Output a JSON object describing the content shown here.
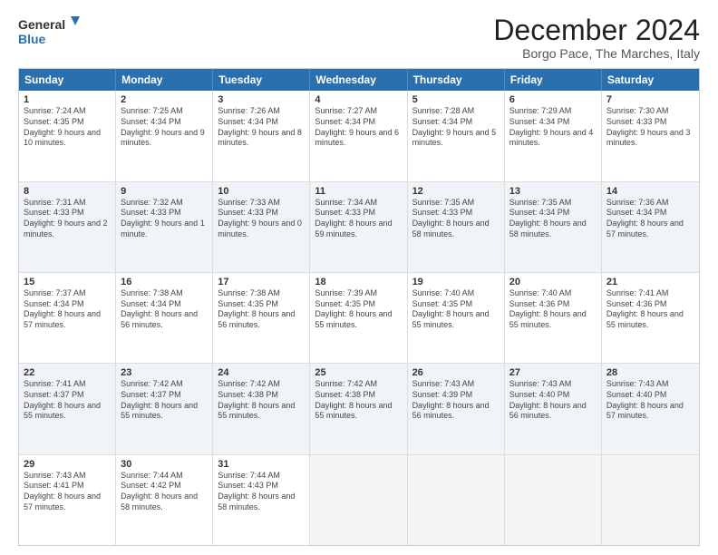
{
  "logo": {
    "line1": "General",
    "line2": "Blue"
  },
  "title": "December 2024",
  "subtitle": "Borgo Pace, The Marches, Italy",
  "header_days": [
    "Sunday",
    "Monday",
    "Tuesday",
    "Wednesday",
    "Thursday",
    "Friday",
    "Saturday"
  ],
  "weeks": [
    [
      {
        "day": "1",
        "rise": "Sunrise: 7:24 AM",
        "set": "Sunset: 4:35 PM",
        "day_text": "Daylight: 9 hours and 10 minutes."
      },
      {
        "day": "2",
        "rise": "Sunrise: 7:25 AM",
        "set": "Sunset: 4:34 PM",
        "day_text": "Daylight: 9 hours and 9 minutes."
      },
      {
        "day": "3",
        "rise": "Sunrise: 7:26 AM",
        "set": "Sunset: 4:34 PM",
        "day_text": "Daylight: 9 hours and 8 minutes."
      },
      {
        "day": "4",
        "rise": "Sunrise: 7:27 AM",
        "set": "Sunset: 4:34 PM",
        "day_text": "Daylight: 9 hours and 6 minutes."
      },
      {
        "day": "5",
        "rise": "Sunrise: 7:28 AM",
        "set": "Sunset: 4:34 PM",
        "day_text": "Daylight: 9 hours and 5 minutes."
      },
      {
        "day": "6",
        "rise": "Sunrise: 7:29 AM",
        "set": "Sunset: 4:34 PM",
        "day_text": "Daylight: 9 hours and 4 minutes."
      },
      {
        "day": "7",
        "rise": "Sunrise: 7:30 AM",
        "set": "Sunset: 4:33 PM",
        "day_text": "Daylight: 9 hours and 3 minutes."
      }
    ],
    [
      {
        "day": "8",
        "rise": "Sunrise: 7:31 AM",
        "set": "Sunset: 4:33 PM",
        "day_text": "Daylight: 9 hours and 2 minutes."
      },
      {
        "day": "9",
        "rise": "Sunrise: 7:32 AM",
        "set": "Sunset: 4:33 PM",
        "day_text": "Daylight: 9 hours and 1 minute."
      },
      {
        "day": "10",
        "rise": "Sunrise: 7:33 AM",
        "set": "Sunset: 4:33 PM",
        "day_text": "Daylight: 9 hours and 0 minutes."
      },
      {
        "day": "11",
        "rise": "Sunrise: 7:34 AM",
        "set": "Sunset: 4:33 PM",
        "day_text": "Daylight: 8 hours and 59 minutes."
      },
      {
        "day": "12",
        "rise": "Sunrise: 7:35 AM",
        "set": "Sunset: 4:33 PM",
        "day_text": "Daylight: 8 hours and 58 minutes."
      },
      {
        "day": "13",
        "rise": "Sunrise: 7:35 AM",
        "set": "Sunset: 4:34 PM",
        "day_text": "Daylight: 8 hours and 58 minutes."
      },
      {
        "day": "14",
        "rise": "Sunrise: 7:36 AM",
        "set": "Sunset: 4:34 PM",
        "day_text": "Daylight: 8 hours and 57 minutes."
      }
    ],
    [
      {
        "day": "15",
        "rise": "Sunrise: 7:37 AM",
        "set": "Sunset: 4:34 PM",
        "day_text": "Daylight: 8 hours and 57 minutes."
      },
      {
        "day": "16",
        "rise": "Sunrise: 7:38 AM",
        "set": "Sunset: 4:34 PM",
        "day_text": "Daylight: 8 hours and 56 minutes."
      },
      {
        "day": "17",
        "rise": "Sunrise: 7:38 AM",
        "set": "Sunset: 4:35 PM",
        "day_text": "Daylight: 8 hours and 56 minutes."
      },
      {
        "day": "18",
        "rise": "Sunrise: 7:39 AM",
        "set": "Sunset: 4:35 PM",
        "day_text": "Daylight: 8 hours and 55 minutes."
      },
      {
        "day": "19",
        "rise": "Sunrise: 7:40 AM",
        "set": "Sunset: 4:35 PM",
        "day_text": "Daylight: 8 hours and 55 minutes."
      },
      {
        "day": "20",
        "rise": "Sunrise: 7:40 AM",
        "set": "Sunset: 4:36 PM",
        "day_text": "Daylight: 8 hours and 55 minutes."
      },
      {
        "day": "21",
        "rise": "Sunrise: 7:41 AM",
        "set": "Sunset: 4:36 PM",
        "day_text": "Daylight: 8 hours and 55 minutes."
      }
    ],
    [
      {
        "day": "22",
        "rise": "Sunrise: 7:41 AM",
        "set": "Sunset: 4:37 PM",
        "day_text": "Daylight: 8 hours and 55 minutes."
      },
      {
        "day": "23",
        "rise": "Sunrise: 7:42 AM",
        "set": "Sunset: 4:37 PM",
        "day_text": "Daylight: 8 hours and 55 minutes."
      },
      {
        "day": "24",
        "rise": "Sunrise: 7:42 AM",
        "set": "Sunset: 4:38 PM",
        "day_text": "Daylight: 8 hours and 55 minutes."
      },
      {
        "day": "25",
        "rise": "Sunrise: 7:42 AM",
        "set": "Sunset: 4:38 PM",
        "day_text": "Daylight: 8 hours and 55 minutes."
      },
      {
        "day": "26",
        "rise": "Sunrise: 7:43 AM",
        "set": "Sunset: 4:39 PM",
        "day_text": "Daylight: 8 hours and 56 minutes."
      },
      {
        "day": "27",
        "rise": "Sunrise: 7:43 AM",
        "set": "Sunset: 4:40 PM",
        "day_text": "Daylight: 8 hours and 56 minutes."
      },
      {
        "day": "28",
        "rise": "Sunrise: 7:43 AM",
        "set": "Sunset: 4:40 PM",
        "day_text": "Daylight: 8 hours and 57 minutes."
      }
    ],
    [
      {
        "day": "29",
        "rise": "Sunrise: 7:43 AM",
        "set": "Sunset: 4:41 PM",
        "day_text": "Daylight: 8 hours and 57 minutes."
      },
      {
        "day": "30",
        "rise": "Sunrise: 7:44 AM",
        "set": "Sunset: 4:42 PM",
        "day_text": "Daylight: 8 hours and 58 minutes."
      },
      {
        "day": "31",
        "rise": "Sunrise: 7:44 AM",
        "set": "Sunset: 4:43 PM",
        "day_text": "Daylight: 8 hours and 58 minutes."
      },
      {
        "day": "",
        "rise": "",
        "set": "",
        "day_text": ""
      },
      {
        "day": "",
        "rise": "",
        "set": "",
        "day_text": ""
      },
      {
        "day": "",
        "rise": "",
        "set": "",
        "day_text": ""
      },
      {
        "day": "",
        "rise": "",
        "set": "",
        "day_text": ""
      }
    ]
  ]
}
